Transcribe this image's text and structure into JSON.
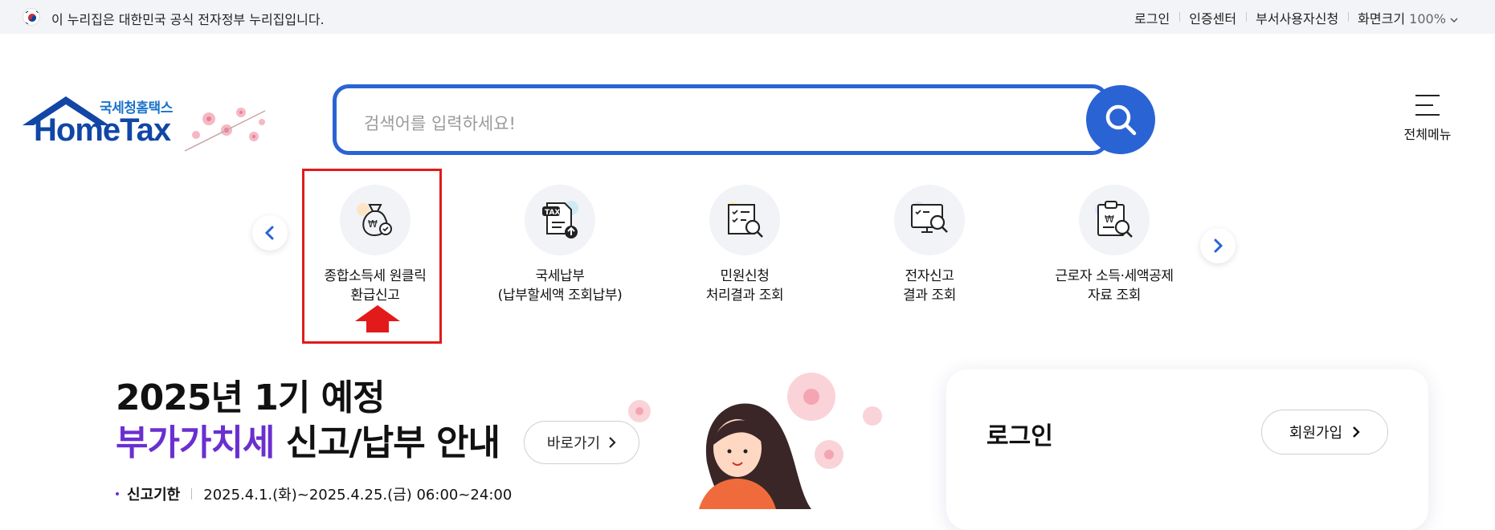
{
  "gov_banner": {
    "text": "이 누리집은 대한민국 공식 전자정부 누리집입니다.",
    "flag_icon": "korea-flag-icon"
  },
  "utility_nav": {
    "login": "로그인",
    "cert_center": "인증센터",
    "dept_user": "부서사용자신청",
    "zoom_label": "화면크기",
    "zoom_value": "100%"
  },
  "logo": {
    "sub": "국세청홈택스",
    "main": "HomeTax"
  },
  "search": {
    "placeholder": "검색어를 입력하세요!",
    "icon": "search-icon"
  },
  "menu": {
    "label": "전체메뉴"
  },
  "quick_menu": {
    "items": [
      {
        "line1": "종합소득세 원클릭",
        "line2": "환급신고"
      },
      {
        "line1": "국세납부",
        "line2": "(납부할세액 조회납부)"
      },
      {
        "line1": "민원신청",
        "line2": "처리결과 조회"
      },
      {
        "line1": "전자신고",
        "line2": "결과 조회"
      },
      {
        "line1": "근로자 소득·세액공제",
        "line2": "자료 조회"
      }
    ]
  },
  "promo": {
    "line1": "2025년 1기 예정",
    "accent": "부가가치세",
    "line2_rest": " 신고/납부 안내",
    "go_button": "바로가기",
    "deadline_label": "신고기한",
    "deadline_value": "2025.4.1.(화)~2025.4.25.(금) 06:00~24:00"
  },
  "login_panel": {
    "title": "로그인",
    "join_button": "회원가입"
  },
  "colors": {
    "primary": "#2a63d4",
    "accent_purple": "#6a2fd0",
    "highlight_red": "#e21a1a"
  }
}
